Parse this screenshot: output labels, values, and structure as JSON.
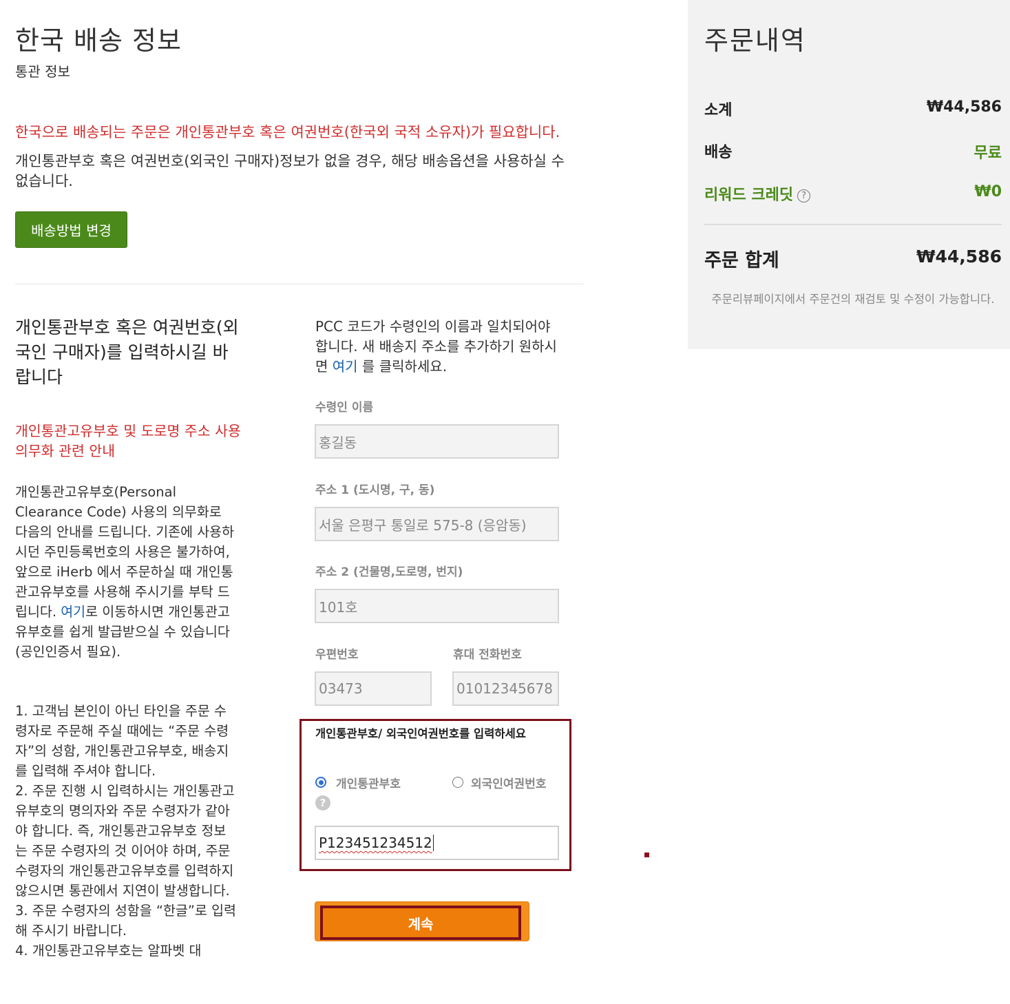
{
  "header": {
    "title": "한국 배송 정보",
    "subtitle": "통관 정보",
    "warning": "한국으로 배송되는 주문은 개인통관부호 혹은 여권번호(한국외 국적 소유자)가 필요합니다.",
    "info": "개인통관부호 혹은 여권번호(외국인 구매자)정보가 없을 경우, 해당 배송옵션을 사용하실 수 없습니다.",
    "change_button": "배송방법 변경"
  },
  "left": {
    "heading": "개인통관부호 혹은 여권번호(외국인 구매자)를 입력하시길 바랍니다",
    "notice_link": "개인통관고유부호 및 도로명 주소 사용 의무화 관련 안내",
    "body_before_link": "개인통관고유부호(Personal Clearance Code) 사용의 의무화로 다음의 안내를 드립니다. 기존에 사용하시던 주민등록번호의 사용은 불가하여, 앞으로 iHerb 에서 주문하실 때 개인통관고유부호를 사용해 주시기를 부탁 드립니다. ",
    "body_link": "여기",
    "body_after_link": "로 이동하시면 개인통관고유부호를 쉽게 발급받으실 수 있습니다 (공인인증서 필요).",
    "list": [
      "1. 고객님 본인이 아닌 타인을 주문 수령자로 주문해 주실 때에는 “주문 수령자”의 성함, 개인통관고유부호, 배송지를 입력해 주셔야 합니다.",
      "2. 주문 진행 시 입력하시는 개인통관고유부호의 명의자와 주문 수령자가 같아야 합니다. 즉, 개인통관고유부호 정보는 주문 수령자의 것 이어야 하며, 주문 수령자의 개인통관고유부호를 입력하지 않으시면 통관에서 지연이 발생합니다.",
      "3. 주문 수령자의 성함을 “한글”로 입력해 주시기 바랍니다.",
      "4. 개인통관고유부호는 알파벳 대"
    ]
  },
  "form": {
    "pcc_note_before": "PCC 코드가 수령인의 이름과 일치되어야 합니다. 새 배송지 주소를 추가하기 원하시면 ",
    "pcc_note_link": "여기",
    "pcc_note_after": " 를 클릭하세요.",
    "recipient_label": "수령인 이름",
    "recipient_value": "홍길동",
    "address1_label": "주소 1 (도시명, 구, 동)",
    "address1_value": "서울 은평구 통일로 575-8 (응암동)",
    "address2_label": "주소 2 (건물명,도로명, 번지)",
    "address2_value": "101호",
    "zip_label": "우편번호",
    "zip_value": "03473",
    "phone_label": "휴대 전화번호",
    "phone_value": "01012345678",
    "pcc_title": "개인통관부호/ 외국인여권번호를 입력하세요",
    "radio_pcc": "개인통관부호",
    "radio_passport": "외국인여권번호",
    "pcc_value": "P123451234512",
    "continue_button": "계속"
  },
  "summary": {
    "title": "주문내역",
    "subtotal_label": "소계",
    "subtotal_value": "₩44,586",
    "shipping_label": "배송",
    "shipping_value": "무료",
    "rewards_label": "리워드 크레딧",
    "rewards_value": "₩0",
    "total_label": "주문 합계",
    "total_value": "₩44,586",
    "note": "주문리뷰페이지에서 주문건의 재검토 및 수정이 가능합니다."
  },
  "colors": {
    "accent_green": "#4b8a1a",
    "warning_red": "#d12d2d",
    "link_blue": "#1a5fa8",
    "continue_orange": "#ef7d0a",
    "highlight_border": "#7d0f1c"
  }
}
